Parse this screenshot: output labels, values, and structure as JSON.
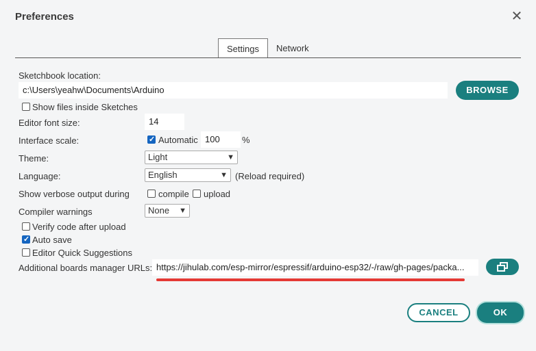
{
  "dialog": {
    "title": "Preferences",
    "close_glyph": "✕"
  },
  "tabs": [
    {
      "label": "Settings",
      "active": true
    },
    {
      "label": "Network",
      "active": false
    }
  ],
  "sketchbook": {
    "label": "Sketchbook location:",
    "value": "c:\\Users\\yeahw\\Documents\\Arduino",
    "browse_label": "BROWSE"
  },
  "show_files": {
    "label": "Show files inside Sketches",
    "checked": false
  },
  "font_size": {
    "label": "Editor font size:",
    "value": "14"
  },
  "interface_scale": {
    "label": "Interface scale:",
    "automatic_label": "Automatic",
    "automatic_checked": true,
    "value": "100",
    "unit": "%"
  },
  "theme": {
    "label": "Theme:",
    "selected": "Light"
  },
  "language": {
    "label": "Language:",
    "selected": "English",
    "note": "(Reload required)"
  },
  "verbose": {
    "label": "Show verbose output during",
    "compile_label": "compile",
    "compile_checked": false,
    "upload_label": "upload",
    "upload_checked": false
  },
  "compiler_warnings": {
    "label": "Compiler warnings",
    "selected": "None"
  },
  "verify": {
    "label": "Verify code after upload",
    "checked": false
  },
  "auto_save": {
    "label": "Auto save",
    "checked": true
  },
  "quick_suggestions": {
    "label": "Editor Quick Suggestions",
    "checked": false
  },
  "boards_urls": {
    "label": "Additional boards manager URLs:",
    "value": "https://jihulab.com/esp-mirror/espressif/arduino-esp32/-/raw/gh-pages/packa..."
  },
  "footer": {
    "cancel_label": "CANCEL",
    "ok_label": "OK"
  },
  "colors": {
    "accent": "#1a7f7f",
    "highlight": "#e53935",
    "checkbox": "#1565c0"
  },
  "icons": {
    "close": "close-icon",
    "window": "open-window-icon",
    "chevron": "chevron-down-icon"
  }
}
